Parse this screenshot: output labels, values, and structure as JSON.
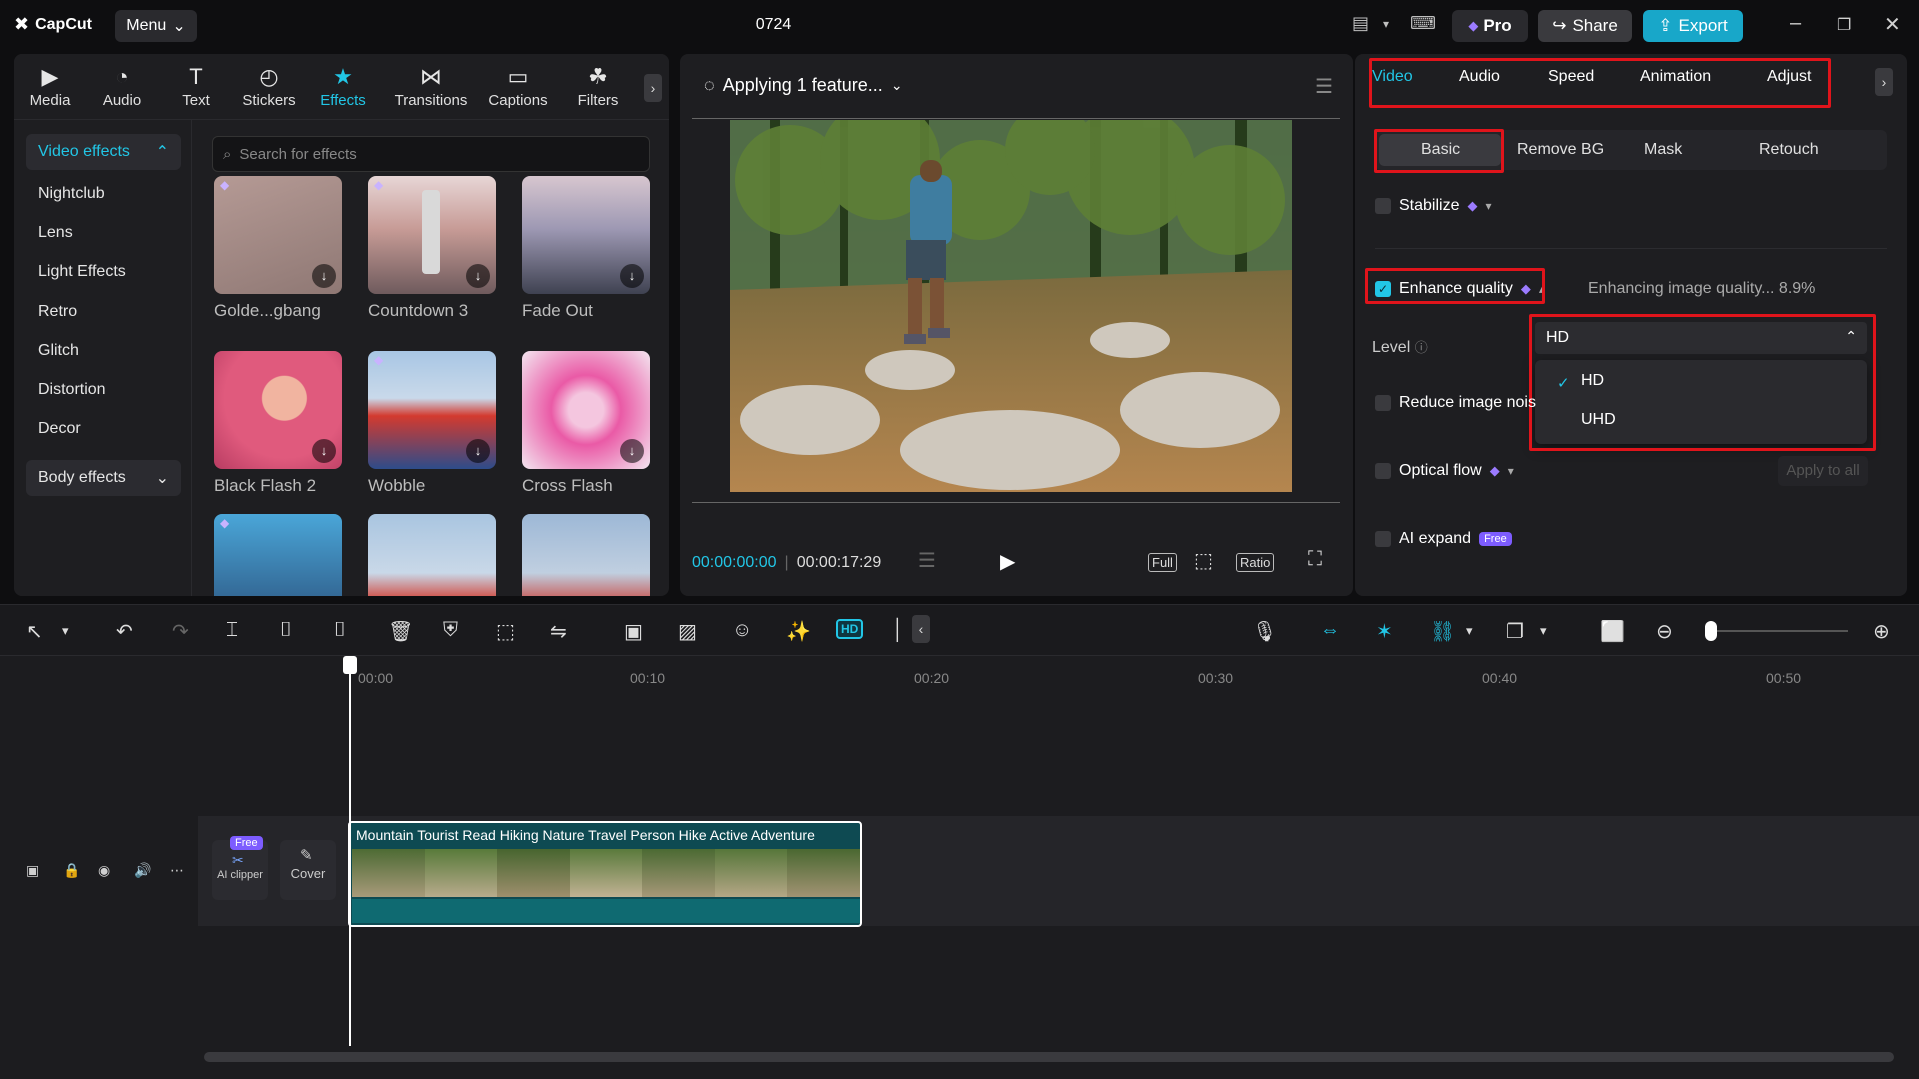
{
  "app": {
    "logo_text": "CapCut",
    "menu_label": "Menu",
    "project_title": "0724",
    "pro_label": "Pro",
    "share_label": "Share",
    "export_label": "Export"
  },
  "tool_tabs": [
    {
      "label": "Media",
      "icon": "media-icon"
    },
    {
      "label": "Audio",
      "icon": "audio-icon"
    },
    {
      "label": "Text",
      "icon": "text-icon"
    },
    {
      "label": "Stickers",
      "icon": "stickers-icon"
    },
    {
      "label": "Effects",
      "icon": "effects-icon",
      "active": true
    },
    {
      "label": "Transitions",
      "icon": "transitions-icon"
    },
    {
      "label": "Captions",
      "icon": "captions-icon"
    },
    {
      "label": "Filters",
      "icon": "filters-icon"
    }
  ],
  "effects_sidebar": {
    "video_effects_label": "Video effects",
    "items": [
      "Nightclub",
      "Lens",
      "Light Effects",
      "Retro",
      "Glitch",
      "Distortion",
      "Decor"
    ],
    "body_effects_label": "Body effects"
  },
  "effects_search": {
    "placeholder": "Search for effects"
  },
  "effects_grid": [
    {
      "label": "Golde...gbang"
    },
    {
      "label": "Countdown 3"
    },
    {
      "label": "Fade Out"
    },
    {
      "label": "Black Flash 2"
    },
    {
      "label": "Wobble"
    },
    {
      "label": "Cross Flash"
    }
  ],
  "preview": {
    "status": "Applying 1 feature...",
    "current_time": "00:00:00:00",
    "total_time": "00:00:17:29",
    "full_label": "Full",
    "ratio_label": "Ratio"
  },
  "properties": {
    "tabs": [
      "Video",
      "Audio",
      "Speed",
      "Animation",
      "Adjust"
    ],
    "sub_tabs": [
      "Basic",
      "Remove BG",
      "Mask",
      "Retouch"
    ],
    "stabilize_label": "Stabilize",
    "enhance_label": "Enhance quality",
    "enhance_status": "Enhancing image quality... 8.9%",
    "level_label": "Level",
    "level_value": "HD",
    "level_options": [
      "HD",
      "UHD"
    ],
    "reduce_noise_label": "Reduce image nois",
    "optical_flow_label": "Optical flow",
    "apply_all_label": "Apply to all",
    "ai_expand_label": "AI expand",
    "free_badge": "Free"
  },
  "timeline": {
    "ruler": [
      "00:00",
      "00:10",
      "00:20",
      "00:30",
      "00:40",
      "00:50"
    ],
    "ai_clipper_label": "AI clipper",
    "ai_clipper_badge": "Free",
    "cover_label": "Cover",
    "clip_title": "Mountain Tourist Read Hiking Nature Travel Person Hike Active Adventure"
  },
  "colors": {
    "accent": "#22c6e6",
    "highlight_box": "#e0141b",
    "pro_gem": "#9b7bff"
  }
}
